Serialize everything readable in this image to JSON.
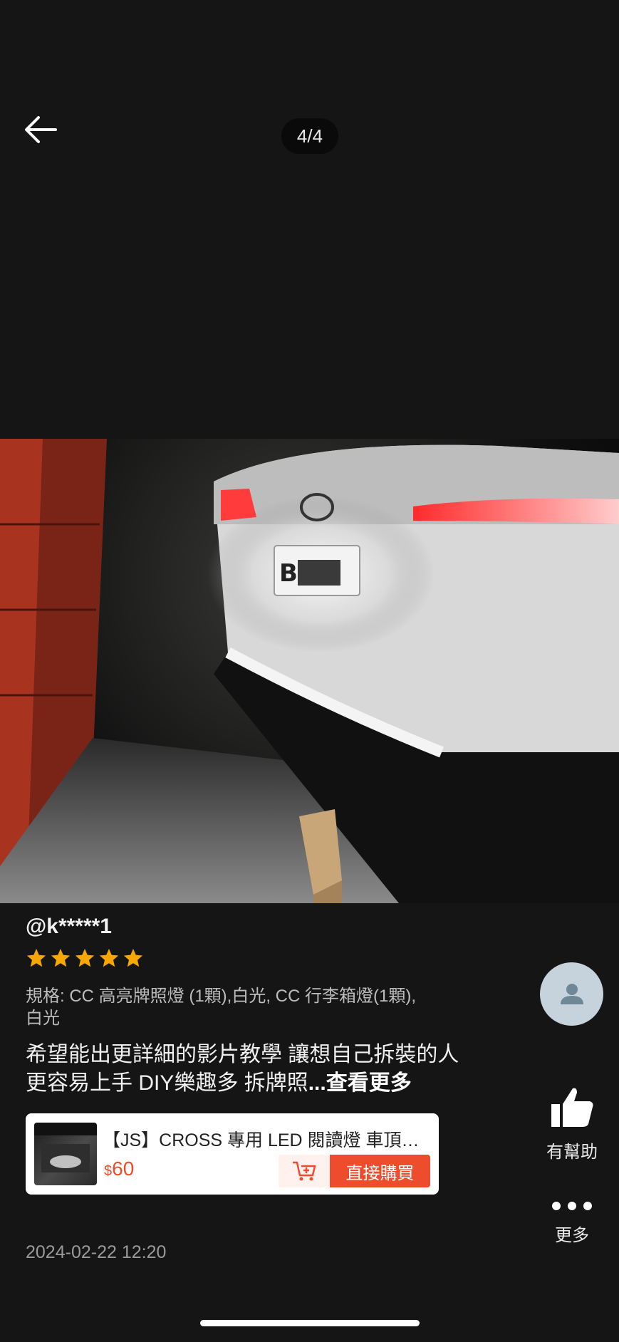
{
  "header": {
    "back_icon": "arrow-left-icon",
    "page_counter": "4/4"
  },
  "photo": {
    "plate_text": "BGK"
  },
  "review": {
    "username": "@k*****1",
    "rating": 5,
    "rating_max": 5,
    "star_color": "#f6a700",
    "variation": "規格: CC 高亮牌照燈 (1顆),白光, CC 行李箱燈(1顆),白光",
    "text": "希望能出更詳細的影片教學 讓想自己拆裝的人 更容易上手 DIY樂趣多 拆牌照",
    "more_label": "...查看更多",
    "date": "2024-02-22 12:20"
  },
  "product": {
    "name": "【JS】CROSS 專用 LED 閱讀燈 車頂燈 室內燈",
    "currency": "$",
    "price": "60",
    "cart_icon": "add-to-cart-icon",
    "buy_label": "直接購買",
    "accent_color": "#ee4d2d"
  },
  "sidebar": {
    "avatar_icon": "user-icon",
    "helpful_label": "有幫助",
    "helpful_icon": "thumbs-up-icon",
    "more_label": "更多",
    "more_icon": "more-dots-icon"
  }
}
